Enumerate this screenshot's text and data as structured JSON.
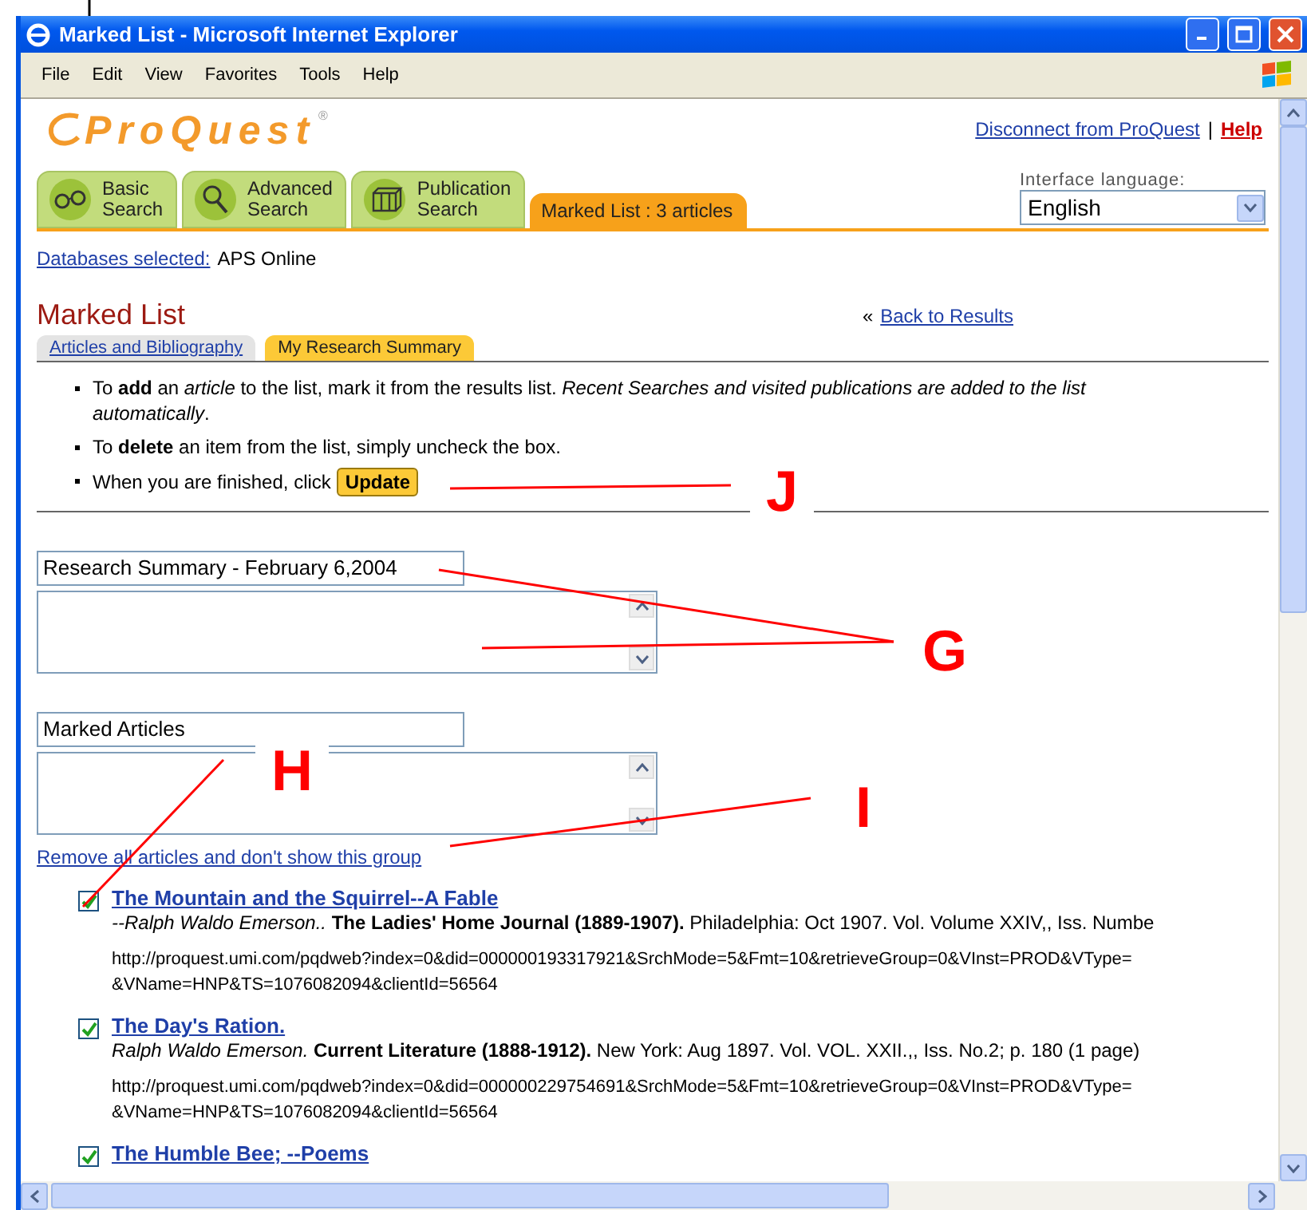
{
  "window": {
    "title": "Marked List - Microsoft Internet Explorer"
  },
  "menu": [
    "File",
    "Edit",
    "View",
    "Favorites",
    "Tools",
    "Help"
  ],
  "logo": {
    "text": "ProQuest",
    "mark": "®"
  },
  "header_separator": "|",
  "header_links": [
    {
      "label": "Disconnect from ProQuest",
      "kind": "link"
    },
    {
      "label": "Help",
      "kind": "help"
    }
  ],
  "search_tabs": [
    {
      "lines": [
        "Basic",
        "Search"
      ],
      "kind": "glasses",
      "selected": false
    },
    {
      "lines": [
        "Advanced",
        "Search"
      ],
      "kind": "magnifier",
      "selected": false
    },
    {
      "lines": [
        "Publication",
        "Search"
      ],
      "kind": "books",
      "selected": false
    },
    {
      "lines": [
        "Marked List  : 3 articles"
      ],
      "kind": "plain",
      "selected": true
    }
  ],
  "language": {
    "label": "Interface language:",
    "value": "English"
  },
  "databases": {
    "label": "Databases selected:",
    "value": "APS Online"
  },
  "page_title": "Marked List",
  "back_link": {
    "prefix": "«",
    "label": "Back to Results"
  },
  "subtabs": [
    {
      "label": "Articles and Bibliography",
      "selected": false
    },
    {
      "label": "My Research Summary",
      "selected": true
    }
  ],
  "instructions": [
    "To **add** an *article* to the list, mark it from the results list. *Recent Searches and visited publications are added to the list automatically*.",
    "To **delete** an item from the list, simply uncheck the box.",
    "When you are finished, click"
  ],
  "update_button": "Update",
  "groups": [
    {
      "title": "Research Summary -  February 6,2004"
    },
    {
      "title": "Marked Articles"
    }
  ],
  "remove_link": "Remove all articles and don't show this group",
  "articles": [
    {
      "checked": true,
      "title": "The Mountain and the Squirrel--A Fable",
      "citation": "*--Ralph Waldo Emerson..* **The Ladies' Home Journal (1889-1907).** Philadelphia: Oct 1907. Vol. Volume XXIV,, Iss. Numbe",
      "url": [
        "http://proquest.umi.com/pqdweb?index=0&did=000000193317921&SrchMode=5&Fmt=10&retrieveGroup=0&VInst=PROD&VType=",
        "&VName=HNP&TS=1076082094&clientId=56564"
      ]
    },
    {
      "checked": true,
      "title": "The Day's Ration.",
      "citation": "*Ralph Waldo Emerson.* **Current Literature (1888-1912).** New York: Aug 1897. Vol. VOL. XXII.,, Iss. No.2; p. 180 (1 page)",
      "url": [
        "http://proquest.umi.com/pqdweb?index=0&did=000000229754691&SrchMode=5&Fmt=10&retrieveGroup=0&VInst=PROD&VType=",
        "&VName=HNP&TS=1076082094&clientId=56564"
      ]
    },
    {
      "checked": true,
      "title": "The Humble Bee; --Poems"
    }
  ],
  "annotations": [
    {
      "letter": "J"
    },
    {
      "letter": "G"
    },
    {
      "letter": "H"
    },
    {
      "letter": "I"
    }
  ]
}
